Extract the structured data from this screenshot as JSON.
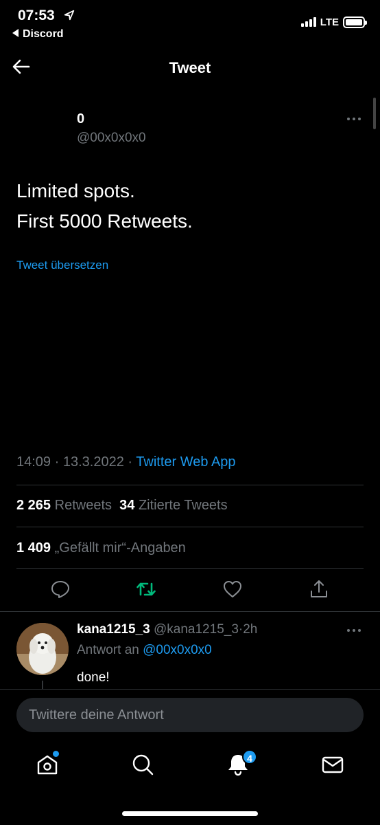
{
  "status_bar": {
    "time": "07:53",
    "back_app": "Discord",
    "network": "LTE",
    "signal_bars": 4
  },
  "header": {
    "title": "Tweet"
  },
  "tweet": {
    "author_name": "0",
    "author_handle": "@00x0x0x0",
    "text_lines": [
      "Limited spots.",
      "First 5000 Retweets."
    ],
    "translate_label": "Tweet übersetzen",
    "time": "14:09",
    "date": "13.3.2022",
    "source": "Twitter Web App",
    "separator": "·",
    "retweets_count": "2 265",
    "retweets_label": "Retweets",
    "quotes_count": "34",
    "quotes_label": "Zitierte Tweets",
    "likes_count": "1 409",
    "likes_label": "„Gefällt mir“-Angaben"
  },
  "reply": {
    "name": "kana1215_3",
    "handle": "@kana1215_3",
    "separator": "·",
    "age": "2h",
    "reply_to_label": "Antwort an",
    "reply_to_handle": "@00x0x0x0",
    "text": "done!"
  },
  "compose": {
    "placeholder": "Twittere deine Antwort"
  },
  "tab_bar": {
    "notifications_badge": "4"
  },
  "colors": {
    "accent": "#1d9bf0",
    "retweet_active": "#00ba7c",
    "background": "#000000",
    "muted_text": "#71767b"
  }
}
